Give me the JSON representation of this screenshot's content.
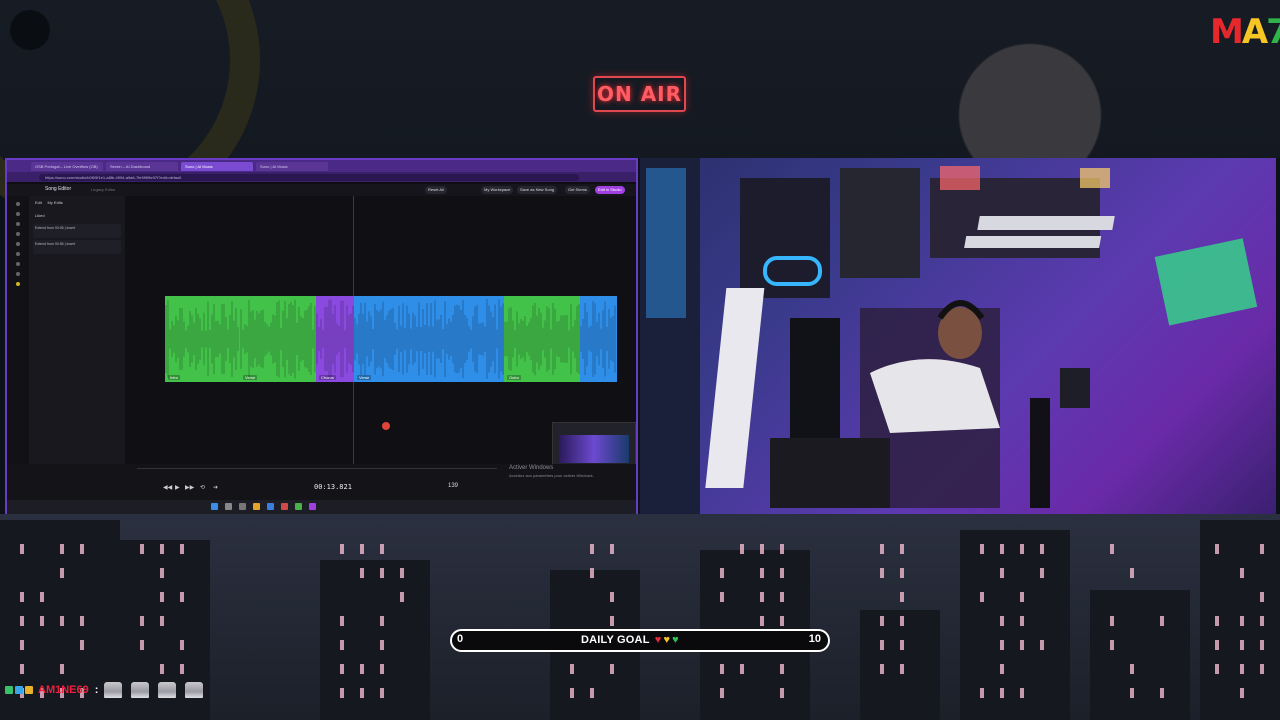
{
  "overlay": {
    "on_air": "ON AIR",
    "logo": {
      "m": "M",
      "a": "A",
      "n": "7"
    }
  },
  "browser": {
    "tabs": [
      "OSB Portugal – Live Overflow (OB)",
      "Serein – AI Dashboard",
      "Suno | AI Music",
      "Suno | AI Music"
    ],
    "url": "https://suno.com/studio/b0f09f1e1-a8fb-4994-a9a6-7fe9f9f9e97f?edit=default"
  },
  "app": {
    "title": "Song Editor",
    "subtitle": "Legacy Editor",
    "header_buttons": [
      "Reset All",
      "My Workspace",
      "Save as New Song",
      "Get Stems",
      "Edit in Studio"
    ],
    "side_tabs": [
      "Edit",
      "My Edits"
    ],
    "side_heading": "Liked",
    "side_items": [
      "Extend from 00:05 | Insert",
      "Extend from 00:55 | Insert"
    ],
    "clips": [
      "Intro",
      "Verse",
      "Chorus",
      "Verse",
      "Outro"
    ]
  },
  "player": {
    "time": "00:13.821",
    "bpm": "139",
    "activate_title": "Activer Windows",
    "activate_sub": "Accédez aux paramètres pour activer Windows."
  },
  "goal": {
    "min": "0",
    "max": "10",
    "label": "DAILY GOAL"
  },
  "chat": {
    "username": "AM1NE69",
    "separator": ":"
  },
  "colors": {
    "on_air": "#ff5d63",
    "frame": "#6a3cc6",
    "clip_green": "#43c24a",
    "clip_purple": "#8a4ae0",
    "clip_blue": "#2f8ee8",
    "username": "#f01e3c"
  }
}
